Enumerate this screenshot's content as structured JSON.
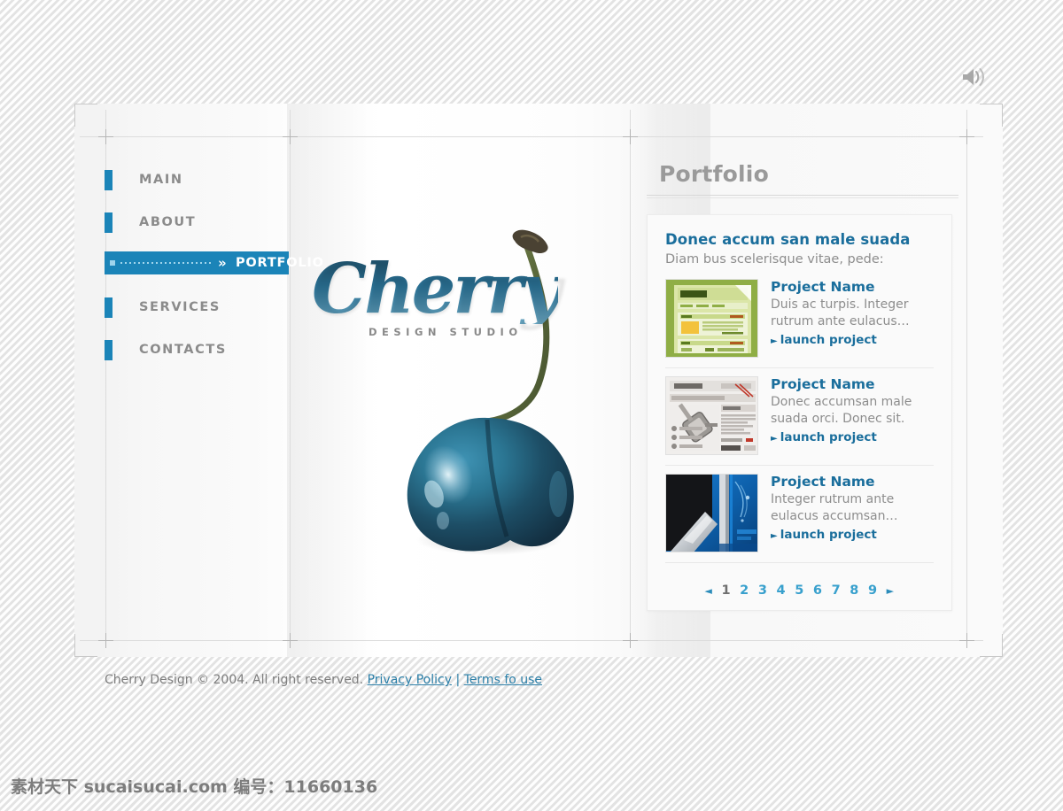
{
  "site": {
    "logo_text": "Cherry",
    "logo_sub": "DESIGN STUDIO",
    "sound_icon": "speaker-icon"
  },
  "nav": {
    "items": [
      {
        "label": "MAIN",
        "active": false
      },
      {
        "label": "ABOUT",
        "active": false
      },
      {
        "label": "PORTFOLIO",
        "active": true
      },
      {
        "label": "SERVICES",
        "active": false
      },
      {
        "label": "CONTACTS",
        "active": false
      }
    ]
  },
  "portfolio": {
    "title": "Portfolio",
    "card": {
      "heading": "Donec accum san male suada",
      "subheading": "Diam bus scelerisque vitae, pede:",
      "projects": [
        {
          "name": "Project Name",
          "description": "Duis ac turpis. Integer rutrum ante eulacus…",
          "link_label": "launch project",
          "thumb": "green-website-thumbnail"
        },
        {
          "name": "Project Name",
          "description": "Donec accumsan male suada orci. Donec sit.",
          "link_label": "launch project",
          "thumb": "grey-website-thumbnail"
        },
        {
          "name": "Project Name",
          "description": "Integer rutrum ante eulacus accumsan…",
          "link_label": "launch project",
          "thumb": "blue-abstract-thumbnail"
        }
      ],
      "pagination": {
        "prev": "◄",
        "next": "►",
        "pages": [
          "1",
          "2",
          "3",
          "4",
          "5",
          "6",
          "7",
          "8",
          "9"
        ],
        "current": "1"
      }
    }
  },
  "footer": {
    "copyright": "Cherry Design © 2004. All right reserved.",
    "privacy_label": "Privacy Policy",
    "separator": "|",
    "terms_label": "Terms fo use"
  },
  "watermark": {
    "text": "素材天下 sucaisucai.com  编号：11660136"
  },
  "colors": {
    "accent_blue": "#1b84b8",
    "link_blue": "#1a6e9c",
    "page_blue": "#38a0cd",
    "text_grey": "#8d8d8d",
    "title_grey": "#9a9a9a"
  }
}
